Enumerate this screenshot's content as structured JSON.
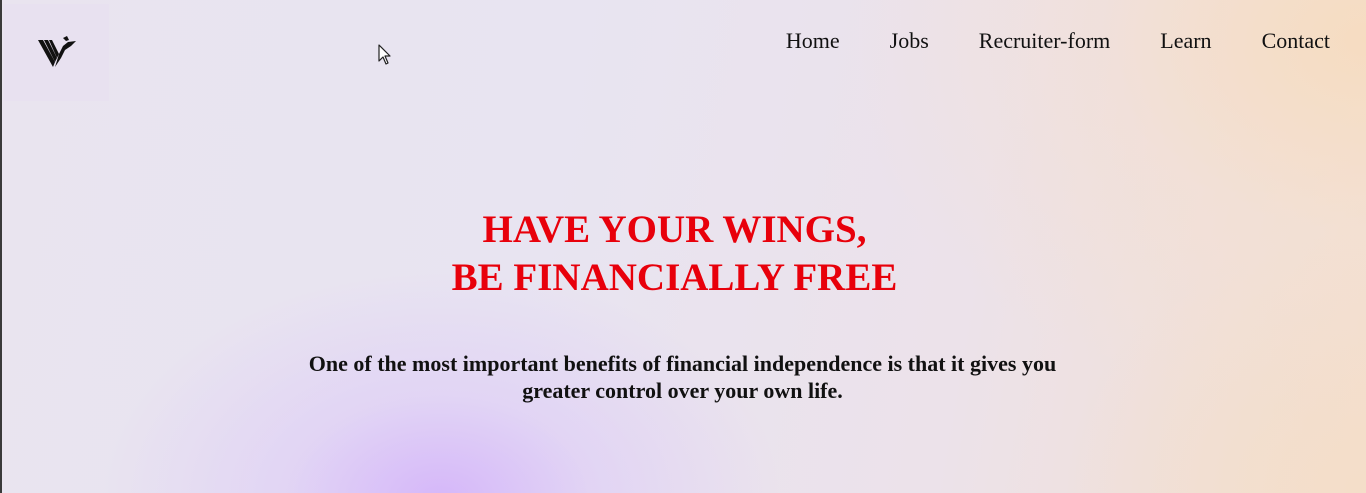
{
  "logo": {
    "icon": "wings-v-logo"
  },
  "nav": {
    "items": [
      {
        "label": "Home"
      },
      {
        "label": "Jobs"
      },
      {
        "label": "Recruiter-form"
      },
      {
        "label": "Learn"
      },
      {
        "label": "Contact"
      }
    ]
  },
  "hero": {
    "title_line1": "HAVE YOUR WINGS,",
    "title_line2": "BE FINANCIALLY FREE",
    "subtitle": "One of the most important benefits of financial independence is that it gives you greater control over your own life.",
    "title_color": "#e8000b"
  },
  "cursor": {
    "icon": "mouse-pointer-icon"
  }
}
